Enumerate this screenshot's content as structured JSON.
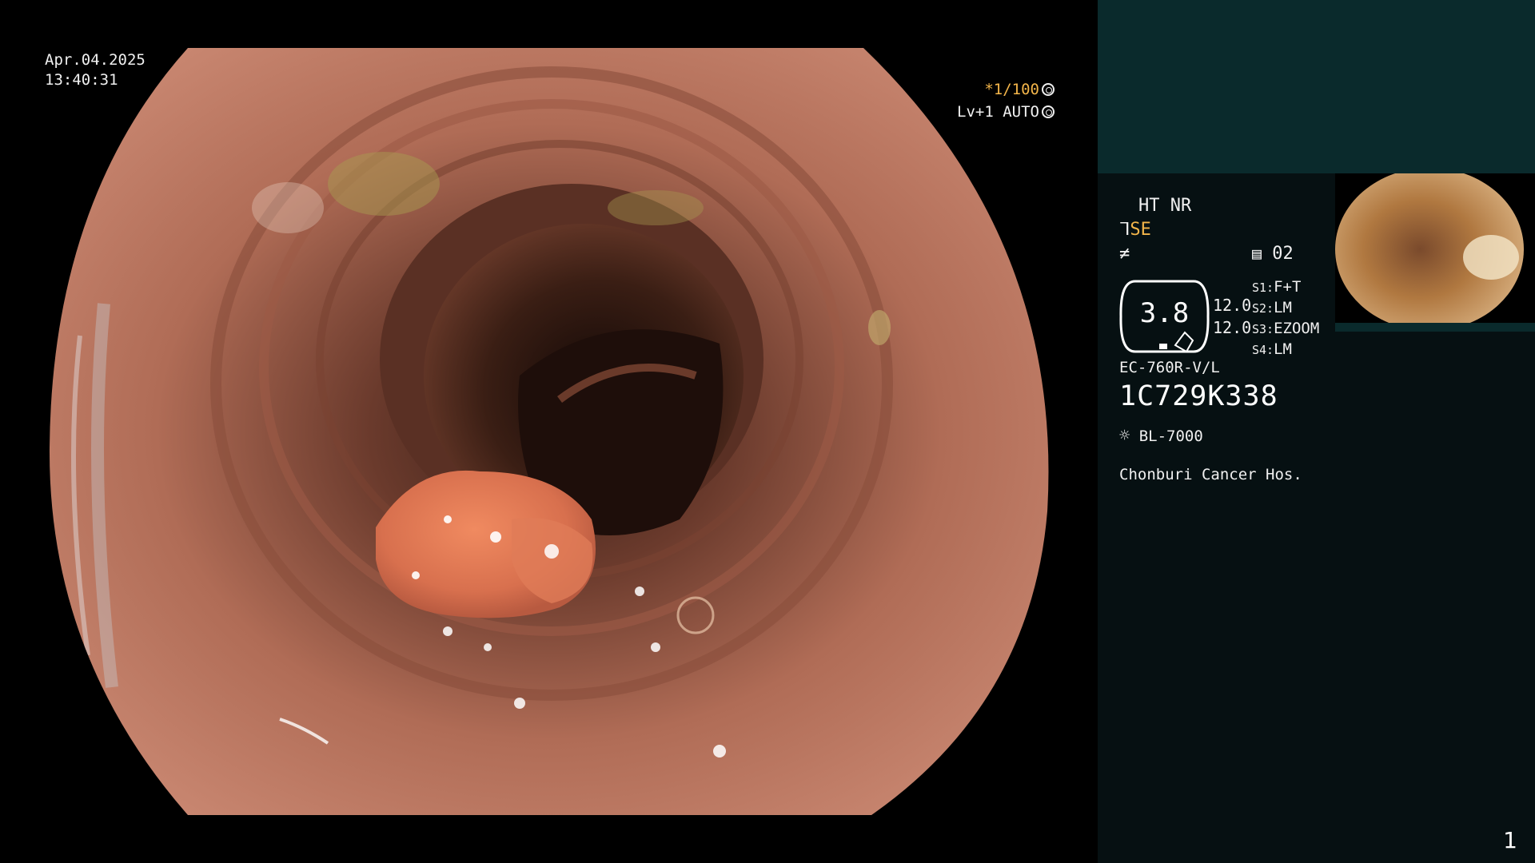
{
  "overlay": {
    "date": "Apr.04.2025",
    "time": "13:40:31",
    "shutter": "*1/100",
    "iris": "Lv+1 AUTO"
  },
  "panel": {
    "ht_nr": "HT NR",
    "se_label": "SE",
    "memo_num": "02",
    "zoom_value": "3.8",
    "val_1": "12.0",
    "val_2": "12.0",
    "switches": [
      {
        "key": "S1:",
        "value": "F+T"
      },
      {
        "key": "S2:",
        "value": "LM"
      },
      {
        "key": "S3:",
        "value": "EZOOM"
      },
      {
        "key": "S4:",
        "value": "LM"
      }
    ],
    "scope_model": "EC-760R-V/L",
    "serial": "1C729K338",
    "light_source": "BL-7000",
    "hospital": "Chonburi Cancer Hos.",
    "page_number": "1"
  },
  "colors": {
    "accent_orange": "#f3b54a",
    "panel_top": "#0a2a2c",
    "panel_bg": "#061012"
  }
}
